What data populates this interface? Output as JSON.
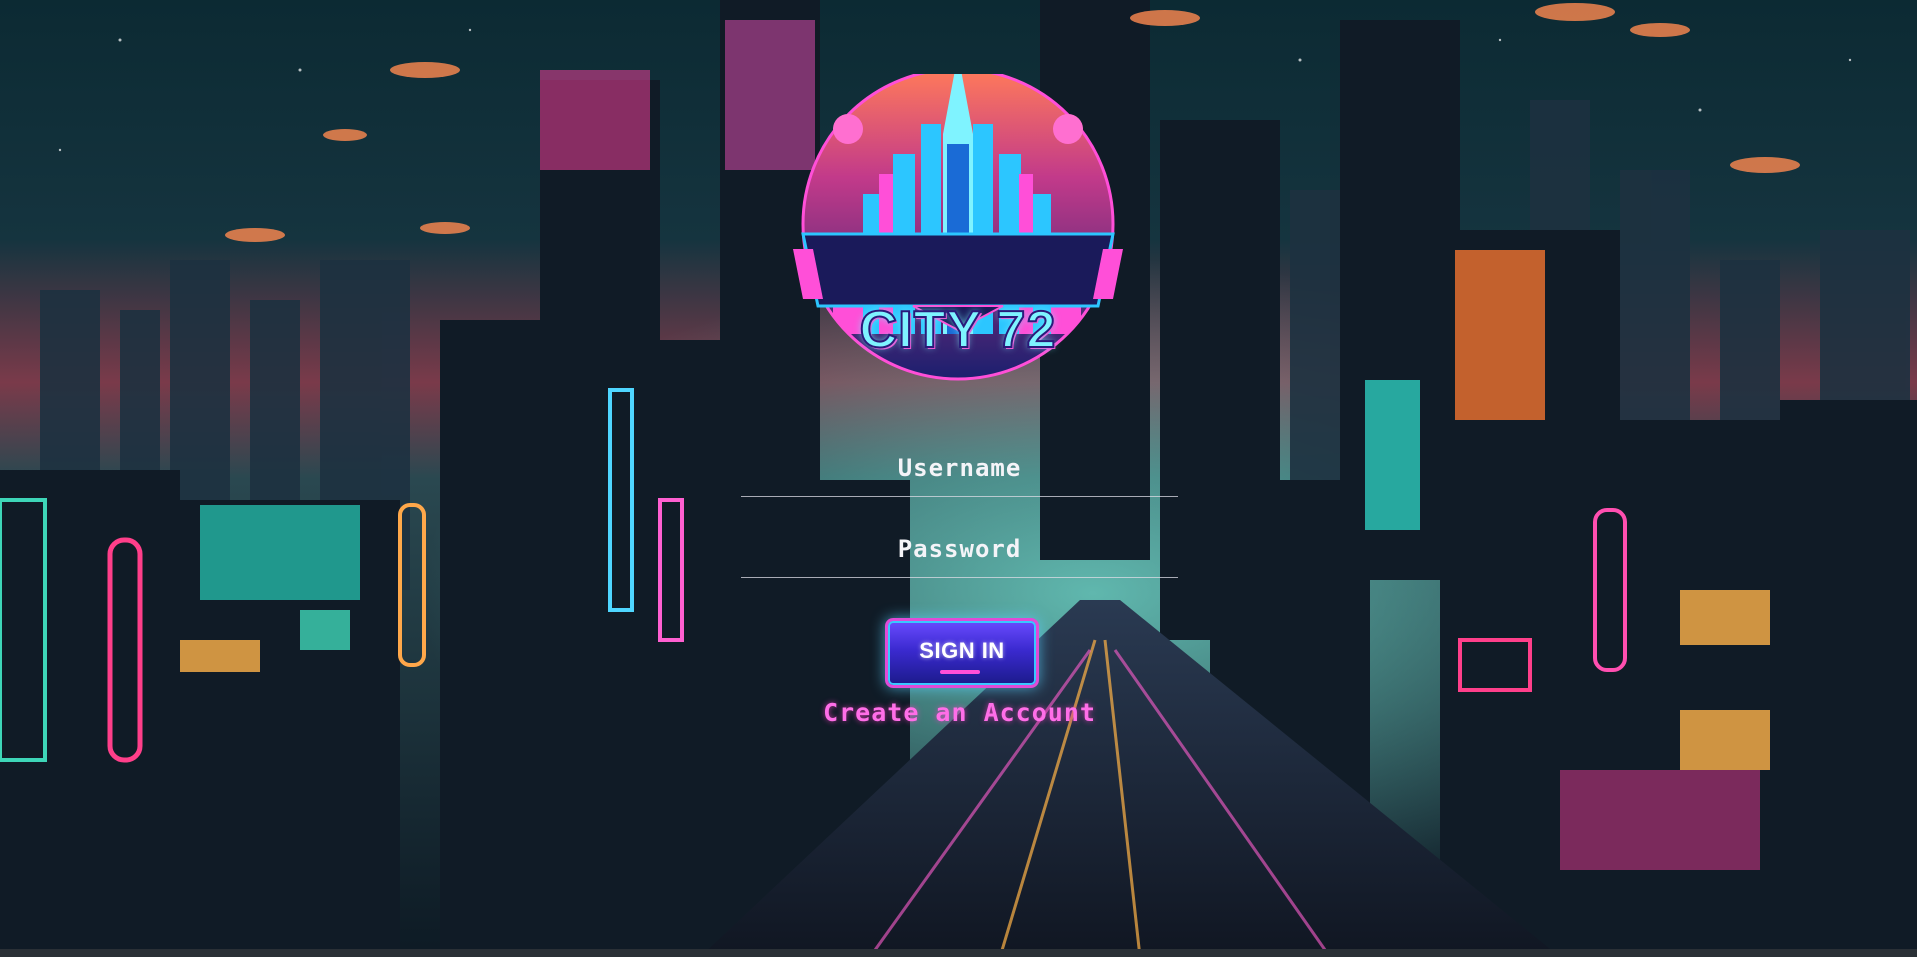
{
  "logo": {
    "text": "CITY 72"
  },
  "login": {
    "username_placeholder": "Username",
    "password_placeholder": "Password",
    "signin_label": "SIGN IN",
    "create_account_label": "Create an Account"
  },
  "colors": {
    "accent_pink": "#ff6ee8",
    "accent_cyan": "#39c8ff",
    "button_purple": "#3b2ad0"
  }
}
